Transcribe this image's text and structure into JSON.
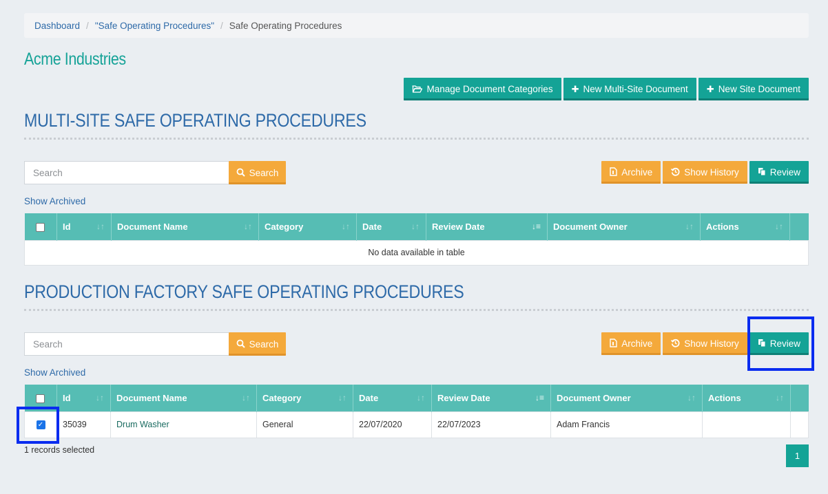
{
  "breadcrumb": {
    "items": [
      "Dashboard",
      "\"Safe Operating Procedures\""
    ],
    "current": "Safe Operating Procedures",
    "separator": "/"
  },
  "company_name": "Acme Industries",
  "top_actions": {
    "manage_categories": "Manage Document Categories",
    "new_multi_site": "New Multi-Site Document",
    "new_site": "New Site Document"
  },
  "sections": [
    {
      "title": "MULTI-SITE SAFE OPERATING PROCEDURES",
      "search_placeholder": "Search",
      "search_button": "Search",
      "archive_button": "Archive",
      "history_button": "Show History",
      "review_button": "Review",
      "show_archived": "Show Archived",
      "columns": [
        "Id",
        "Document Name",
        "Category",
        "Date",
        "Review Date",
        "Document Owner",
        "Actions"
      ],
      "empty_message": "No data available in table",
      "rows": []
    },
    {
      "title": "PRODUCTION FACTORY SAFE OPERATING PROCEDURES",
      "search_placeholder": "Search",
      "search_button": "Search",
      "archive_button": "Archive",
      "history_button": "Show History",
      "review_button": "Review",
      "show_archived": "Show Archived",
      "columns": [
        "Id",
        "Document Name",
        "Category",
        "Date",
        "Review Date",
        "Document Owner",
        "Actions"
      ],
      "rows": [
        {
          "checked": true,
          "id": "35039",
          "document_name": "Drum Washer",
          "category": "General",
          "date": "22/07/2020",
          "review_date": "22/07/2023",
          "owner": "Adam Francis",
          "actions": ""
        }
      ],
      "records_selected": "1 records selected",
      "page": "1"
    }
  ],
  "colors": {
    "teal": "#14a396",
    "header_teal": "#56bdb4",
    "orange": "#f4a93b",
    "link_blue": "#2e6aa8",
    "highlight": "#0a2cf0"
  }
}
